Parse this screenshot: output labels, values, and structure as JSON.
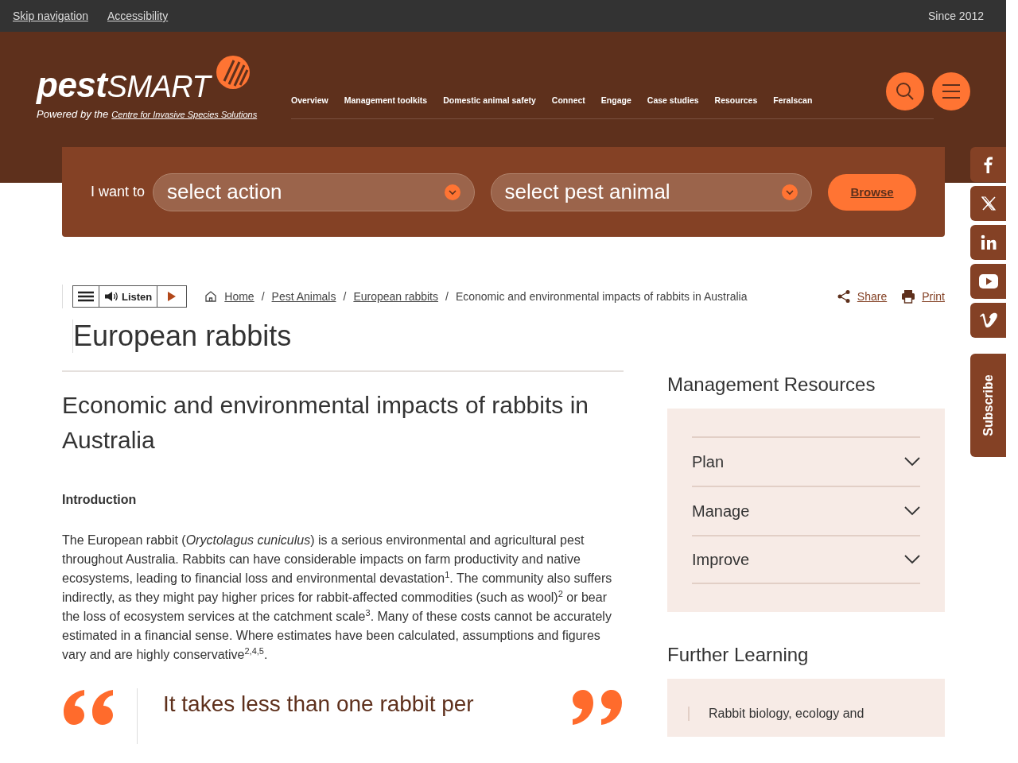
{
  "top_bar": {
    "links": [
      "Skip navigation",
      "Accessibility"
    ],
    "tagline": "Since 2012"
  },
  "header": {
    "logo": {
      "bold": "pest",
      "light": "SMART"
    },
    "powered_by": {
      "prefix": "Powered by the",
      "link": "Centre for Invasive Species Solutions"
    },
    "nav": [
      "Overview",
      "Management toolkits",
      "Domestic animal safety",
      "Connect",
      "Engage",
      "Case studies",
      "Resources",
      "Feralscan"
    ]
  },
  "finder": {
    "label": "I want to",
    "selects": [
      "select action",
      "select pest animal"
    ],
    "button": "Browse"
  },
  "listen": {
    "label": "Listen"
  },
  "breadcrumb_separator": "/",
  "breadcrumb": [
    {
      "label": "Home",
      "link": true
    },
    {
      "label": "Pest Animals",
      "link": true
    },
    {
      "label": "European rabbits",
      "link": true
    },
    {
      "label": "Economic and environmental impacts of rabbits in Australia",
      "link": false
    }
  ],
  "page_actions": [
    {
      "kind": "share",
      "label": "Share"
    },
    {
      "kind": "print",
      "label": "Print"
    }
  ],
  "page_title": "European rabbits",
  "article": {
    "heading": "Economic and environmental impacts of rabbits in Australia",
    "section_heading": "Introduction",
    "paragraph": "The European rabbit (*Oryctolagus cuniculus*) is a serious environmental and agricultural pest throughout Australia. Rabbits can have considerable impacts on farm productivity and native ecosystems, leading to financial loss and environmental devastation$^{1}$. The community also suffers indirectly, as they might pay higher prices for rabbit-affected commodities (such as wool)$^{2}$ or bear the loss of ecosystem services at the catchment scale$^{3}$. Many of these costs cannot be accurately estimated in a financial sense. Where estimates have been calculated, assumptions and figures vary and are highly conservative$^{2,4,5}$.",
    "quote": "It takes less than one rabbit per"
  },
  "sidebar": [
    {
      "kind": "accordion",
      "title": "Management Resources",
      "items": [
        {
          "label": "Plan",
          "expanded": false
        },
        {
          "label": "Manage",
          "expanded": false
        },
        {
          "label": "Improve",
          "expanded": false
        }
      ]
    },
    {
      "kind": "links",
      "title": "Further Learning",
      "items": [
        {
          "label": "Rabbit biology, ecology and"
        }
      ]
    }
  ],
  "social": [
    {
      "kind": "facebook"
    },
    {
      "kind": "x"
    },
    {
      "kind": "linkedin"
    },
    {
      "kind": "youtube"
    },
    {
      "kind": "vimeo"
    }
  ],
  "subscribe": "Subscribe"
}
